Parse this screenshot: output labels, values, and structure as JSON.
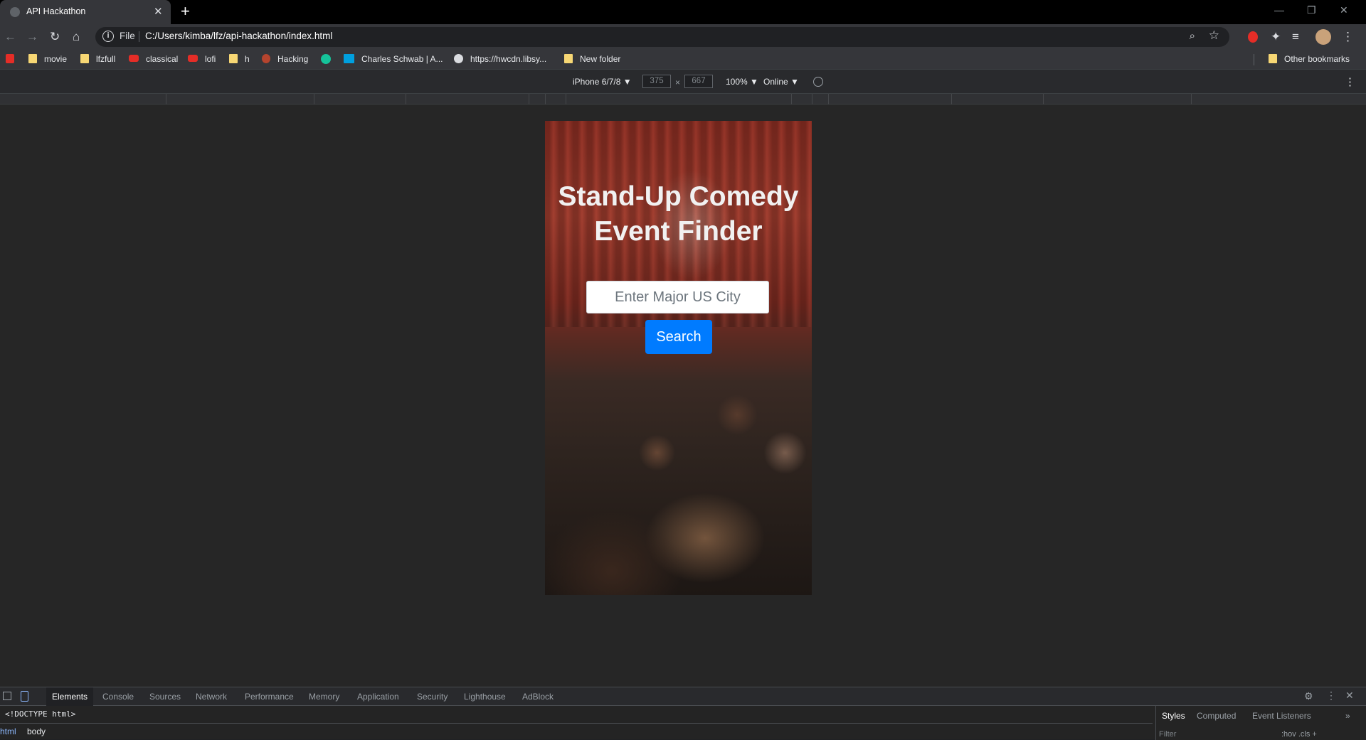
{
  "tab": {
    "title": "API Hackathon",
    "close_glyph": "✕",
    "new_tab_glyph": "+"
  },
  "window_controls": {
    "minimize": "—",
    "restore": "❐",
    "close": "✕"
  },
  "toolbar": {
    "back_glyph": "←",
    "forward_glyph": "→",
    "reload_glyph": "↻",
    "home_glyph": "⌂",
    "scheme_label": "File",
    "url": "C:/Users/kimba/lfz/api-hackathon/index.html",
    "menu_glyph": "⋮"
  },
  "bookmarks": [
    {
      "label": "",
      "icon": "speaker-icon"
    },
    {
      "label": "movie",
      "icon": "folder-icon"
    },
    {
      "label": "lfzfull",
      "icon": "folder-icon"
    },
    {
      "label": "classical",
      "icon": "youtube-icon"
    },
    {
      "label": "lofi",
      "icon": "youtube-icon"
    },
    {
      "label": "h",
      "icon": "folder-icon"
    },
    {
      "label": "Hacking",
      "icon": "hacking-icon"
    },
    {
      "label": "",
      "icon": "grammarly-icon"
    },
    {
      "label": "Charles Schwab | A...",
      "icon": "schwab-icon"
    },
    {
      "label": "https://hwcdn.libsy...",
      "icon": "globe-icon"
    },
    {
      "label": "New folder",
      "icon": "folder-icon"
    }
  ],
  "other_bookmarks": "Other bookmarks",
  "device_toolbar": {
    "device": "iPhone 6/7/8 ▼",
    "width": "375",
    "times": "×",
    "height": "667",
    "zoom": "100% ▼",
    "network": "Online ▼",
    "more_glyph": "⋮"
  },
  "page": {
    "headline_line1": "Stand-Up Comedy",
    "headline_line2": "Event Finder",
    "city_placeholder": "Enter Major US City",
    "search_button": "Search"
  },
  "devtools": {
    "tabs": [
      "Elements",
      "Console",
      "Sources",
      "Network",
      "Performance",
      "Memory",
      "Application",
      "Security",
      "Lighthouse",
      "AdBlock"
    ],
    "active_tab": "Elements",
    "dom_line": "<!DOCTYPE html>",
    "breadcrumbs": [
      "html",
      "body"
    ],
    "side_tabs": [
      "Styles",
      "Computed",
      "Event Listeners"
    ],
    "side_more": "»",
    "filter_placeholder": "Filter",
    "filter_tools": ":hov  .cls  +"
  },
  "colors": {
    "accent_button": "#007bff",
    "browser_frame": "#35363a",
    "viewport_bg": "#262626"
  }
}
